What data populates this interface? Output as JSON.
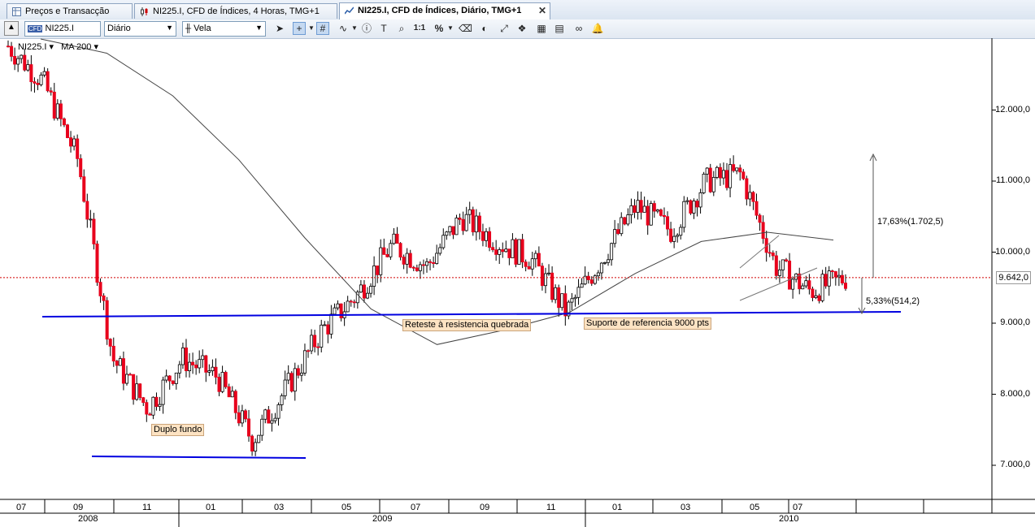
{
  "tabs": [
    {
      "label": "Preços e Transacção",
      "icon": "price-grid-icon",
      "active": false,
      "closable": false
    },
    {
      "label": "NI225.I, CFD de Índices, 4 Horas, TMG+1",
      "icon": "candle-chart-icon",
      "active": false,
      "closable": false
    },
    {
      "label": "NI225.I, CFD de Índices, Diário, TMG+1",
      "icon": "candle-chart-icon",
      "active": true,
      "closable": true,
      "close": "✕"
    }
  ],
  "toolbar": {
    "symbol": "NI225.I",
    "symbol_badge": "CFD",
    "period": "Diário",
    "chart_type": "Vela",
    "dropdown_arrow": "▼",
    "tool_labels": [
      "1:1",
      "%"
    ]
  },
  "legend": {
    "symbol": "NI225.I ▾",
    "indicator": "MA 200 ▾"
  },
  "colors": {
    "up": "#ffffff",
    "down": "#e8001c",
    "support": "#0000e0",
    "ma": "#444444",
    "price_line": "#d00000"
  },
  "annotations": {
    "double_bottom": "Duplo fundo",
    "retest": "Reteste à resistencia quebrada",
    "support": "Suporte de referencia 9000 pts"
  },
  "measurements": {
    "up_move": "17,63%(1.702,5)",
    "down_move": "5,33%(514,2)"
  },
  "current_price_label": "9.642,0",
  "chart_data": {
    "type": "line",
    "symbol": "NI225.I",
    "timeframe": "Diário",
    "y_ticks": [
      "12.000,0",
      "11.000,0",
      "10.000,0",
      "9.000,0",
      "8.000,0",
      "7.000,0"
    ],
    "y_tick_values": [
      12000,
      11000,
      10000,
      9000,
      8000,
      7000
    ],
    "ylim": [
      6700,
      13000
    ],
    "x_month_ticks": [
      "07",
      "09",
      "11",
      "01",
      "03",
      "05",
      "07",
      "09",
      "11",
      "01",
      "03",
      "05",
      "07"
    ],
    "x_year_ticks": [
      "2008",
      "2009",
      "2010"
    ],
    "current_price": 9642.0,
    "series": [
      {
        "name": "NI225.I",
        "x": [
          "2008-07",
          "2008-08",
          "2008-09",
          "2008-10",
          "2008-11",
          "2008-12",
          "2009-01",
          "2009-02",
          "2009-03",
          "2009-04",
          "2009-05",
          "2009-06",
          "2009-07",
          "2009-08",
          "2009-09",
          "2009-10",
          "2009-11",
          "2009-12",
          "2010-01",
          "2010-02",
          "2010-03",
          "2010-04",
          "2010-05",
          "2010-06",
          "2010-07"
        ],
        "values": [
          12900,
          12400,
          11300,
          8500,
          7800,
          8500,
          8250,
          7350,
          8100,
          8900,
          9400,
          10100,
          9800,
          10500,
          10150,
          9900,
          9150,
          9900,
          10650,
          10300,
          11000,
          11100,
          9800,
          9450,
          9640
        ]
      },
      {
        "name": "MA 200",
        "x": [
          "2008-07",
          "2008-09",
          "2008-11",
          "2009-01",
          "2009-03",
          "2009-05",
          "2009-07",
          "2009-09",
          "2009-11",
          "2010-01",
          "2010-03",
          "2010-05",
          "2010-07"
        ],
        "values": [
          13000,
          12800,
          12200,
          11300,
          10200,
          9200,
          8700,
          8900,
          9150,
          9700,
          10150,
          10280,
          10170
        ]
      }
    ],
    "annotations": [
      "Duplo fundo",
      "Reteste à resistencia quebrada",
      "Suporte de referencia 9000 pts"
    ]
  }
}
